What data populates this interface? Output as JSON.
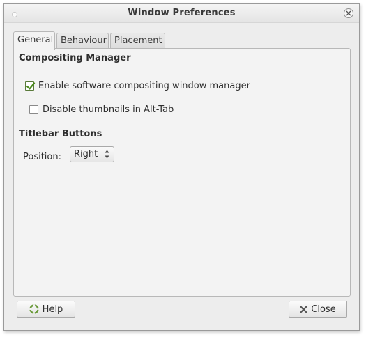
{
  "window": {
    "title": "Window Preferences"
  },
  "tabs": [
    {
      "label": "General",
      "active": true
    },
    {
      "label": "Behaviour",
      "active": false
    },
    {
      "label": "Placement",
      "active": false
    }
  ],
  "compositing": {
    "heading": "Compositing Manager",
    "enable_label": "Enable software compositing window manager",
    "enable_checked": true,
    "thumbnails_label": "Disable thumbnails in Alt-Tab",
    "thumbnails_checked": false
  },
  "titlebar_buttons": {
    "heading": "Titlebar Buttons",
    "position_label": "Position:",
    "position_value": "Right"
  },
  "buttons": {
    "help": "Help",
    "close": "Close"
  },
  "icons": {
    "window_close": "close-circle-icon",
    "help": "lifebuoy-icon",
    "close": "x-icon",
    "cursor": "mouse-pointer-icon"
  },
  "colors": {
    "check_green": "#4a8a1c",
    "close_x": "#555555"
  }
}
